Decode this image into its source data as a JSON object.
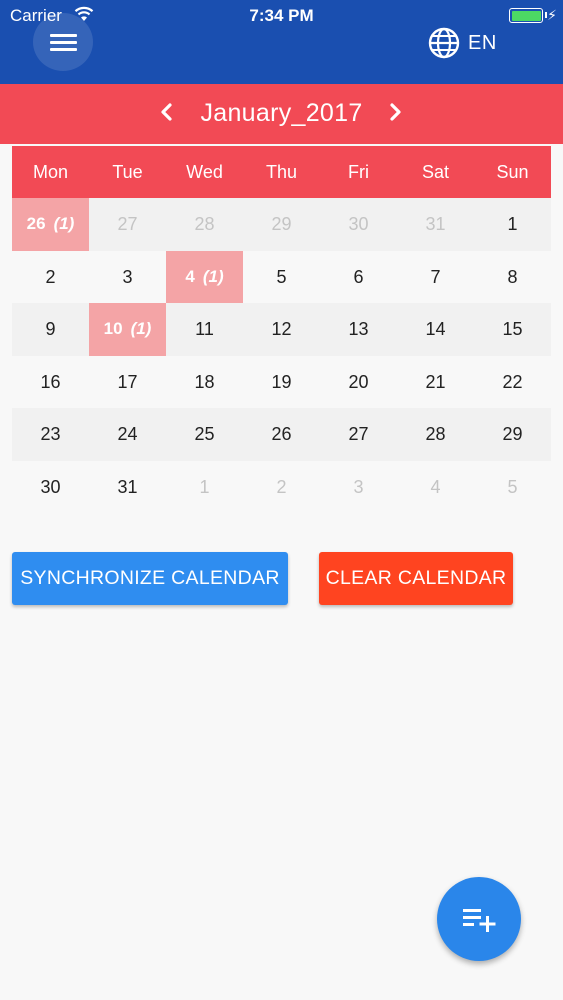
{
  "status_bar": {
    "carrier": "Carrier",
    "time": "7:34 PM"
  },
  "header": {
    "language": "EN"
  },
  "colors": {
    "header_bg": "#1a4fb0",
    "accent_red": "#f24a55",
    "event_bg": "#f4a4a6",
    "sync_button": "#2f8df0",
    "clear_button": "#ff4420",
    "fab": "#2a86ea"
  },
  "icons": {
    "menu": "hamburger-icon",
    "language": "globe-icon",
    "prev": "chevron-left-icon",
    "next": "chevron-right-icon",
    "fab": "playlist-add-icon"
  },
  "calendar": {
    "month_title": "January_2017",
    "weekdays": [
      "Mon",
      "Tue",
      "Wed",
      "Thu",
      "Fri",
      "Sat",
      "Sun"
    ],
    "weeks": [
      [
        {
          "day": "26",
          "muted": false,
          "count": "(1)"
        },
        {
          "day": "27",
          "muted": true
        },
        {
          "day": "28",
          "muted": true
        },
        {
          "day": "29",
          "muted": true
        },
        {
          "day": "30",
          "muted": true
        },
        {
          "day": "31",
          "muted": true
        },
        {
          "day": "1",
          "muted": false
        }
      ],
      [
        {
          "day": "2",
          "muted": false
        },
        {
          "day": "3",
          "muted": false
        },
        {
          "day": "4",
          "muted": false,
          "count": "(1)"
        },
        {
          "day": "5",
          "muted": false
        },
        {
          "day": "6",
          "muted": false
        },
        {
          "day": "7",
          "muted": false
        },
        {
          "day": "8",
          "muted": false
        }
      ],
      [
        {
          "day": "9",
          "muted": false
        },
        {
          "day": "10",
          "muted": false,
          "count": "(1)"
        },
        {
          "day": "11",
          "muted": false
        },
        {
          "day": "12",
          "muted": false
        },
        {
          "day": "13",
          "muted": false
        },
        {
          "day": "14",
          "muted": false
        },
        {
          "day": "15",
          "muted": false
        }
      ],
      [
        {
          "day": "16",
          "muted": false
        },
        {
          "day": "17",
          "muted": false
        },
        {
          "day": "18",
          "muted": false
        },
        {
          "day": "19",
          "muted": false
        },
        {
          "day": "20",
          "muted": false
        },
        {
          "day": "21",
          "muted": false
        },
        {
          "day": "22",
          "muted": false
        }
      ],
      [
        {
          "day": "23",
          "muted": false
        },
        {
          "day": "24",
          "muted": false
        },
        {
          "day": "25",
          "muted": false
        },
        {
          "day": "26",
          "muted": false
        },
        {
          "day": "27",
          "muted": false
        },
        {
          "day": "28",
          "muted": false
        },
        {
          "day": "29",
          "muted": false
        }
      ],
      [
        {
          "day": "30",
          "muted": false
        },
        {
          "day": "31",
          "muted": false
        },
        {
          "day": "1",
          "muted": true
        },
        {
          "day": "2",
          "muted": true
        },
        {
          "day": "3",
          "muted": true
        },
        {
          "day": "4",
          "muted": true
        },
        {
          "day": "5",
          "muted": true
        }
      ]
    ]
  },
  "actions": {
    "sync_label": "SYNCHRONIZE CALENDAR",
    "clear_label": "CLEAR CALENDAR"
  }
}
